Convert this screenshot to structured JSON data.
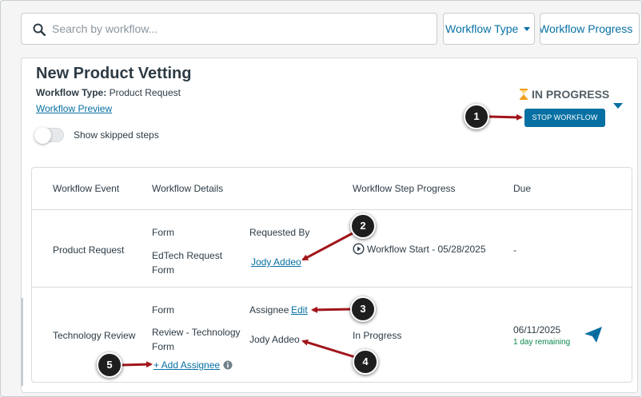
{
  "search": {
    "placeholder": "Search by workflow..."
  },
  "filters": {
    "type_label": "Workflow Type",
    "progress_label": "Workflow Progress"
  },
  "workflow": {
    "title": "New Product Vetting",
    "type_label": "Workflow Type:",
    "type_value": "Product Request",
    "preview_link": "Workflow Preview",
    "toggle_label": "Show skipped steps",
    "status": "IN PROGRESS",
    "stop_button": "STOP WORKFLOW"
  },
  "table": {
    "headers": [
      "Workflow Event",
      "Workflow Details",
      "Workflow Step Progress",
      "Due"
    ],
    "rows": [
      {
        "event": "Product Request",
        "detail_type": "Form",
        "detail_name_1": "EdTech Request",
        "detail_name_2": "Form",
        "person_label": "Requested By",
        "person": "Jody Addeo",
        "progress": "Workflow Start - 05/28/2025",
        "due": "-"
      },
      {
        "event": "Technology Review",
        "detail_type": "Form",
        "detail_name_1": "Review - Technology",
        "detail_name_2": "Form",
        "person_label": "Assignee",
        "edit_link": "Edit",
        "person": "Jody Addeo",
        "add_assignee": "+ Add Assignee",
        "progress": "In Progress",
        "due": "06/11/2025",
        "due_note": "1 day remaining"
      }
    ]
  },
  "callouts": [
    "1",
    "2",
    "3",
    "4",
    "5"
  ],
  "colors": {
    "accent": "#0770a3",
    "callout_arrow": "#a1151b",
    "due_ok": "#0b874b"
  },
  "icons": [
    "search-icon",
    "caret-down-icon",
    "hourglass-icon",
    "play-circle-icon",
    "info-icon",
    "send-icon"
  ]
}
